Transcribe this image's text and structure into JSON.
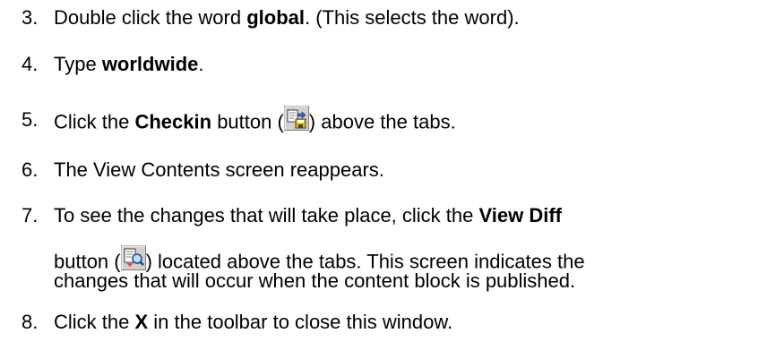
{
  "steps": [
    {
      "number": "3.",
      "parts": [
        "Double click the word ",
        "global",
        ". (This selects the word)."
      ]
    },
    {
      "number": "4.",
      "parts": [
        "Type ",
        "worldwide",
        "."
      ]
    },
    {
      "number": "5.",
      "parts": [
        "Click the ",
        "Checkin",
        " button (",
        ") above the tabs."
      ],
      "icon": "checkin-icon"
    },
    {
      "number": "6.",
      "parts": [
        "The View Contents screen reappears."
      ]
    },
    {
      "number": "7.",
      "parts": [
        "To see the changes that will take place, click the ",
        "View Diff"
      ],
      "continuation": [
        "button (",
        ") located above the tabs. This screen indicates the",
        "changes that will occur when the content block is published."
      ],
      "icon": "view-diff-icon"
    },
    {
      "number": "8.",
      "parts": [
        "Click the ",
        "X",
        " in the toolbar to close this window."
      ]
    }
  ]
}
